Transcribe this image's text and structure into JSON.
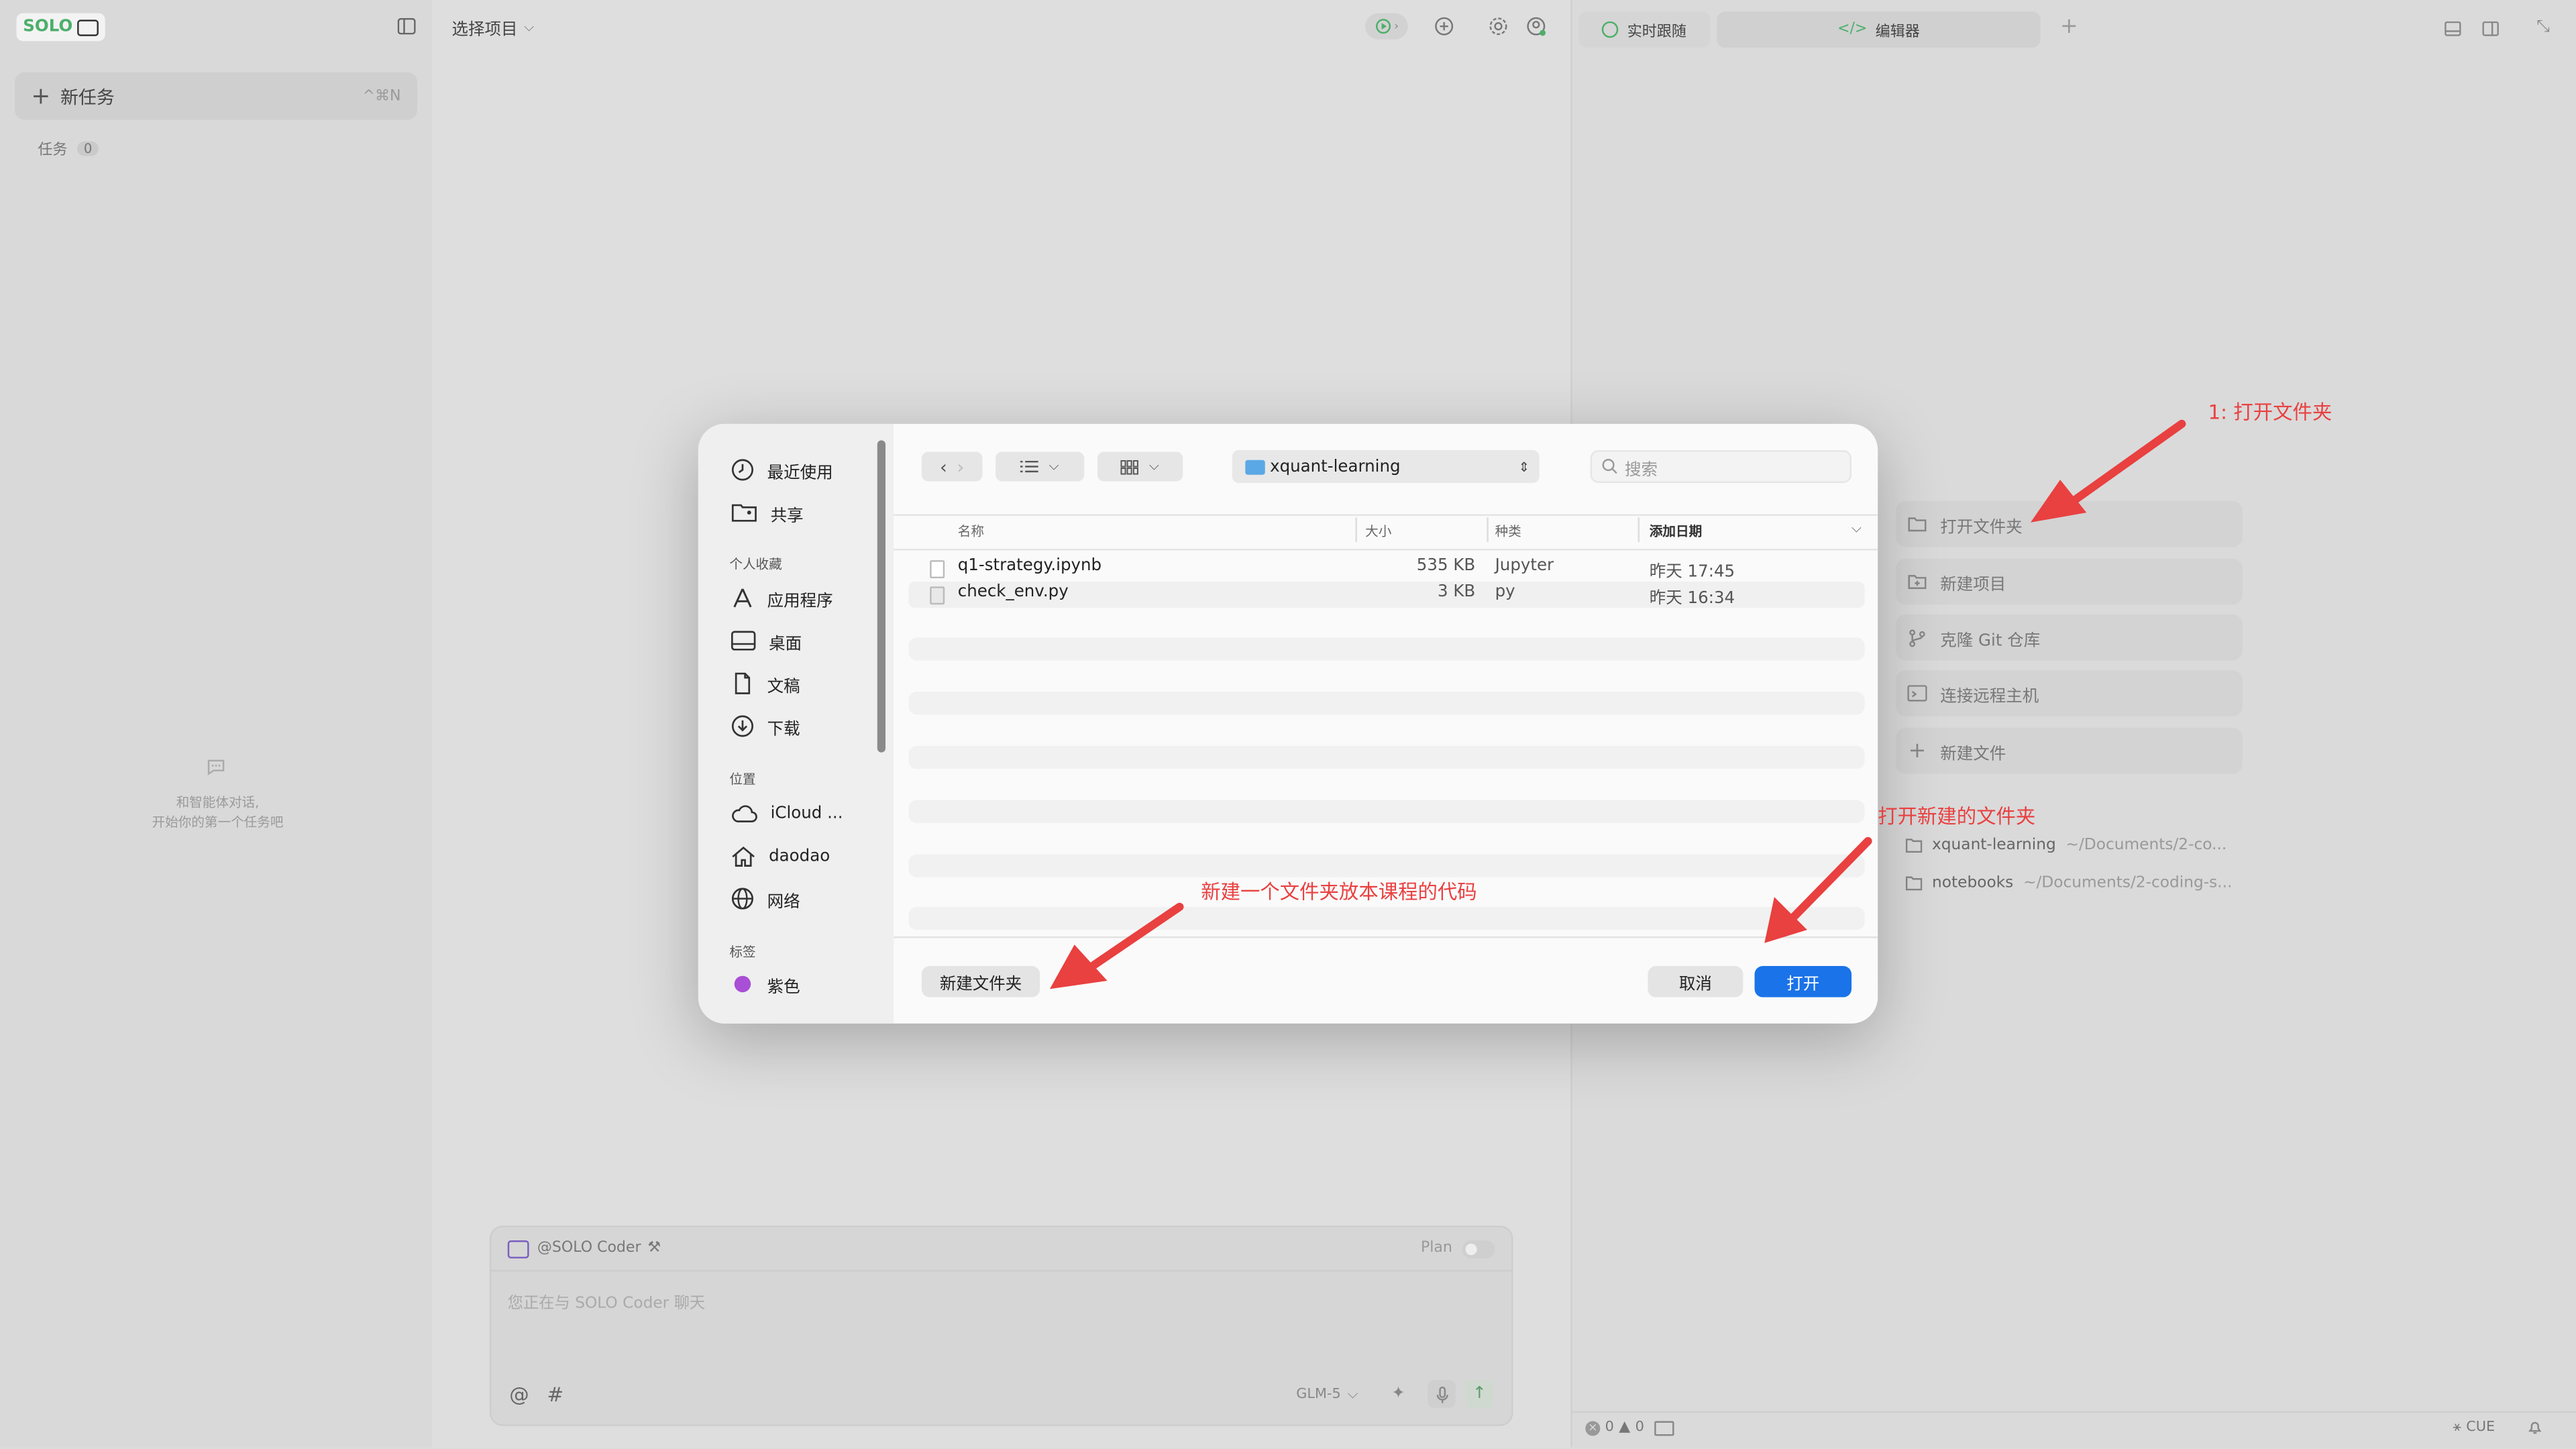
{
  "sidebar": {
    "logo_text": "SOLO",
    "new_task_label": "新任务",
    "new_task_shortcut": "^⌘N",
    "tasks_label": "任务",
    "tasks_count": "0",
    "empty_line1": "和智能体对话,",
    "empty_line2": "开始你的第一个任务吧"
  },
  "main": {
    "project_select": "选择项目",
    "chat": {
      "agent_label": "@SOLO Coder",
      "plan_label": "Plan",
      "placeholder": "您正在与 SOLO Coder 聊天",
      "at_symbol": "@",
      "hash_symbol": "#",
      "model_label": "GLM-5"
    }
  },
  "right_panel": {
    "tabs": [
      {
        "label": "实时跟随"
      },
      {
        "label": "编辑器"
      }
    ],
    "actions": [
      {
        "label": "打开文件夹",
        "icon": "folder-open-icon"
      },
      {
        "label": "新建项目",
        "icon": "new-project-icon"
      },
      {
        "label": "克隆 Git 仓库",
        "icon": "git-branch-icon"
      },
      {
        "label": "连接远程主机",
        "icon": "remote-host-icon"
      },
      {
        "label": "新建文件",
        "icon": "plus-icon"
      }
    ],
    "recent": [
      {
        "name": "xquant-learning",
        "path": "~/Documents/2-co..."
      },
      {
        "name": "notebooks",
        "path": "~/Documents/2-coding-s..."
      }
    ],
    "status": {
      "errors": "0",
      "warnings": "0",
      "language": "CUE"
    }
  },
  "dialog": {
    "sidebar": {
      "recent_label": "最近使用",
      "shared_label": "共享",
      "favorites_section": "个人收藏",
      "favorites": [
        {
          "label": "应用程序",
          "icon": "applications-icon"
        },
        {
          "label": "桌面",
          "icon": "desktop-icon"
        },
        {
          "label": "文稿",
          "icon": "document-icon"
        },
        {
          "label": "下载",
          "icon": "download-icon"
        }
      ],
      "locations_section": "位置",
      "locations": [
        {
          "label": "iCloud ...",
          "icon": "cloud-icon"
        },
        {
          "label": "daodao",
          "icon": "home-icon"
        },
        {
          "label": "网络",
          "icon": "globe-icon"
        }
      ],
      "tags_section": "标签",
      "tag_label": "紫色",
      "tag_color": "#a84fd6"
    },
    "path": "xquant-learning",
    "search_placeholder": "搜索",
    "columns": {
      "name": "名称",
      "size": "大小",
      "kind": "种类",
      "date": "添加日期"
    },
    "files": [
      {
        "name": "q1-strategy.ipynb",
        "size": "535 KB",
        "kind": "Jupyter",
        "date": "昨天 17:45"
      },
      {
        "name": "check_env.py",
        "size": "3 KB",
        "kind": "py",
        "date": "昨天 16:34"
      }
    ],
    "new_folder_button": "新建文件夹",
    "cancel_button": "取消",
    "open_button": "打开",
    "accent_color": "#1a73e8"
  },
  "annotations": {
    "step1": "1:  打开文件夹",
    "open_new_folder": "打开新建的文件夹",
    "new_folder_tip": "新建一个文件夹放本课程的代码"
  }
}
